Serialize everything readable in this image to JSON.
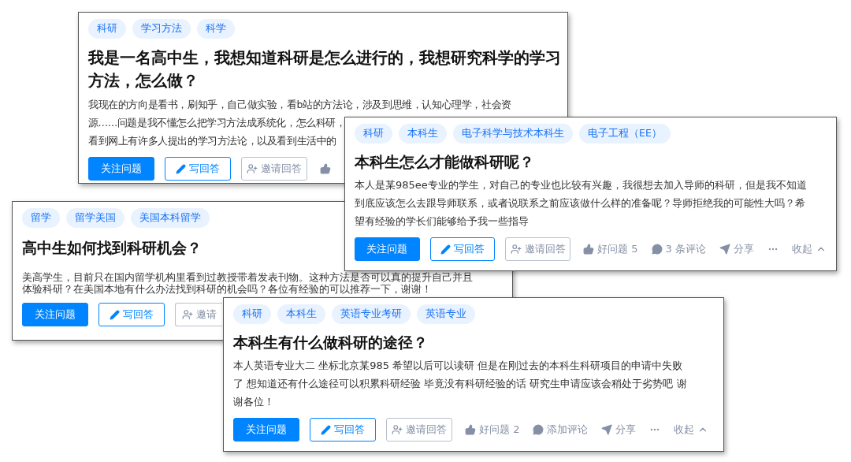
{
  "cards": [
    {
      "tags": [
        "科研",
        "学习方法",
        "科学"
      ],
      "title_lines": [
        "我是一名高中生，我想知道科研是怎么进行的，我想研究科学的学习",
        "方法，怎么做？"
      ],
      "body_lines": [
        "我现在的方向是看书，刷知乎，自己做实验，看b站的方法论，涉及到思维，认知心理学，社会资",
        "源……问题是我不懂怎么把学习方法成系统化，怎么科研，",
        "看到网上有许多人提出的学习方法论，以及看到生活中的"
      ],
      "buttons": [
        {
          "kind": "follow",
          "label": "关注问题"
        },
        {
          "kind": "write",
          "label": "写回答"
        },
        {
          "kind": "invite",
          "label": "邀请回答"
        }
      ],
      "meta": [
        {
          "kind": "like"
        }
      ]
    },
    {
      "tags": [
        "留学",
        "留学美国",
        "美国本科留学"
      ],
      "title_lines": [
        "高中生如何找到科研机会？"
      ],
      "body_lines": [
        "美高学生，目前只在国内留学机构里看到过教授带着发表刊物。这种方法是否可以真的提升自己并且",
        "体验科研？在美国本地有什么办法找到科研的机会吗？各位有经验的可以推荐一下，谢谢！"
      ],
      "buttons": [
        {
          "kind": "follow",
          "label": "关注问题"
        },
        {
          "kind": "write",
          "label": "写回答"
        },
        {
          "kind": "invite",
          "label": "邀请"
        }
      ]
    },
    {
      "tags": [
        "科研",
        "本科生",
        "电子科学与技术本科生",
        "电子工程（EE）"
      ],
      "title_lines": [
        "本科生怎么才能做科研呢？"
      ],
      "body_lines": [
        "本人是某985ee专业的学生，对自己的专业也比较有兴趣，我很想去加入导师的科研，但是我不知道",
        "到底应该怎么去跟导师联系，或者说联系之前应该做什么样的准备呢？导师拒绝我的可能性大吗？希",
        "望有经验的学长们能够给予我一些指导"
      ],
      "buttons": [
        {
          "kind": "follow",
          "label": "关注问题"
        },
        {
          "kind": "write",
          "label": "写回答"
        },
        {
          "kind": "invite",
          "label": "邀请回答"
        }
      ],
      "meta": [
        {
          "kind": "like",
          "label": "好问题 5"
        },
        {
          "kind": "comment",
          "label": "3 条评论"
        },
        {
          "kind": "share",
          "label": "分享"
        },
        {
          "kind": "more"
        },
        {
          "kind": "collapse",
          "label": "收起"
        }
      ]
    },
    {
      "tags": [
        "科研",
        "本科生",
        "英语专业考研",
        "英语专业"
      ],
      "title_lines": [
        "本科生有什么做科研的途径？"
      ],
      "body_lines": [
        "本人英语专业大二 坐标北京某985 希望以后可以读研 但是在刚过去的本科生科研项目的申请中失败",
        "了 想知道还有什么途径可以积累科研经验 毕竟没有科研经验的话 研究生申请应该会稍处于劣势吧 谢",
        "谢各位！"
      ],
      "buttons": [
        {
          "kind": "follow",
          "label": "关注问题"
        },
        {
          "kind": "write",
          "label": "写回答"
        },
        {
          "kind": "invite",
          "label": "邀请回答"
        }
      ],
      "meta": [
        {
          "kind": "like",
          "label": "好问题 2"
        },
        {
          "kind": "comment",
          "label": "添加评论"
        },
        {
          "kind": "share",
          "label": "分享"
        },
        {
          "kind": "more"
        },
        {
          "kind": "collapse",
          "label": "收起"
        }
      ]
    }
  ]
}
